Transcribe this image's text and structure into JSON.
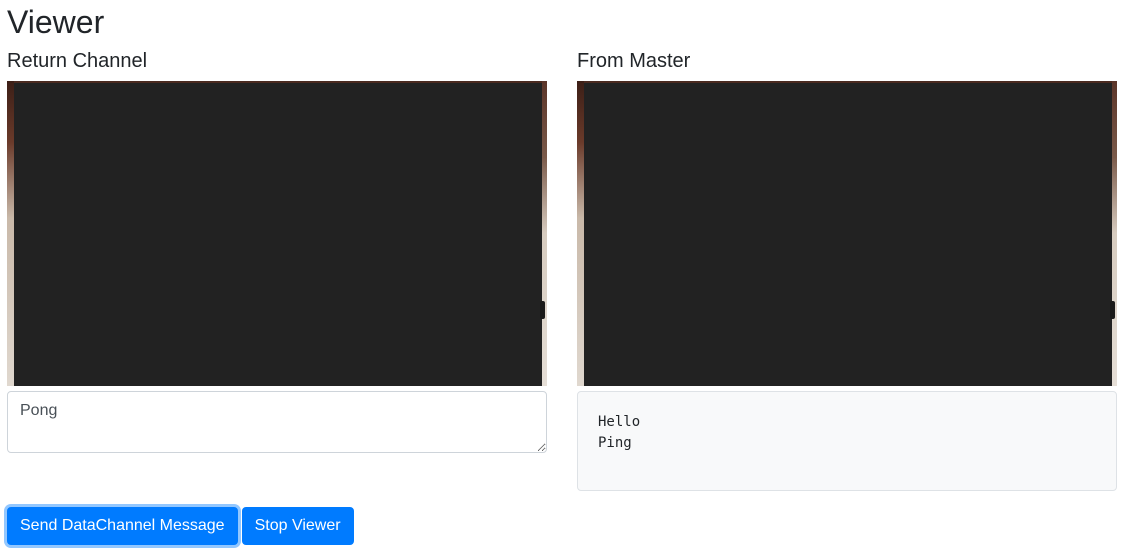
{
  "page": {
    "title": "Viewer"
  },
  "return_channel": {
    "heading": "Return Channel",
    "message_value": "Pong"
  },
  "from_master": {
    "heading": "From Master",
    "log_lines": [
      "Hello",
      "Ping"
    ]
  },
  "actions": {
    "send_label": "Send DataChannel Message",
    "stop_label": "Stop Viewer"
  },
  "colors": {
    "primary": "#007bff",
    "video_frame": "#222222",
    "log_background": "#f8f9fa"
  }
}
